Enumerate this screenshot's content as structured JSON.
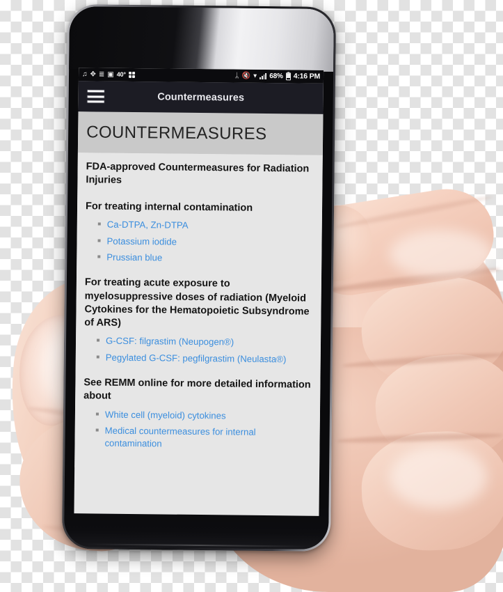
{
  "status_bar": {
    "left_icons": [
      {
        "name": "music-note-icon",
        "glyph": "♫"
      },
      {
        "name": "navigation-arrows-icon",
        "glyph": "✥"
      },
      {
        "name": "layers-icon",
        "glyph": "≣"
      },
      {
        "name": "photo-icon",
        "glyph": "▣"
      }
    ],
    "temperature": "40°",
    "apps_grid_icon": "grid-icon",
    "bluetooth_icon": "ᛦ",
    "mute_icon": "◁",
    "wifi_icon": "wifi-icon",
    "signal_icon": "signal-bars-icon",
    "battery_percent": "68%",
    "battery_icon": "battery-icon",
    "clock": "4:16 PM"
  },
  "app_bar": {
    "menu_icon": "hamburger-menu-icon",
    "title": "Countermeasures"
  },
  "banner": {
    "title": "COUNTERMEASURES"
  },
  "content": {
    "sections": [
      {
        "heading": "FDA-approved Countermeasures for Radiation Injuries",
        "links": []
      },
      {
        "heading": "For treating internal contamination",
        "links": [
          "Ca-DTPA, Zn-DTPA",
          "Potassium iodide",
          "Prussian blue"
        ]
      },
      {
        "heading": "For treating acute exposure to myelosuppressive doses of radiation (Myeloid Cytokines for the Hematopoietic Subsyndrome of ARS)",
        "links": [
          "G-CSF: filgrastim (Neupogen®)",
          "Pegylated G-CSF: pegfilgrastim (Neulasta®)"
        ]
      },
      {
        "heading": "See REMM online for more detailed information about",
        "links": [
          "White cell (myeloid) cytokines",
          "Medical countermeasures for internal contamination"
        ]
      }
    ]
  },
  "colors": {
    "link_blue": "#3b8ede",
    "app_bar": "#1c1c24",
    "banner_bg": "#c9c9c9",
    "content_bg": "#e6e6e6",
    "status_bar_bg": "#0b0b0e"
  }
}
